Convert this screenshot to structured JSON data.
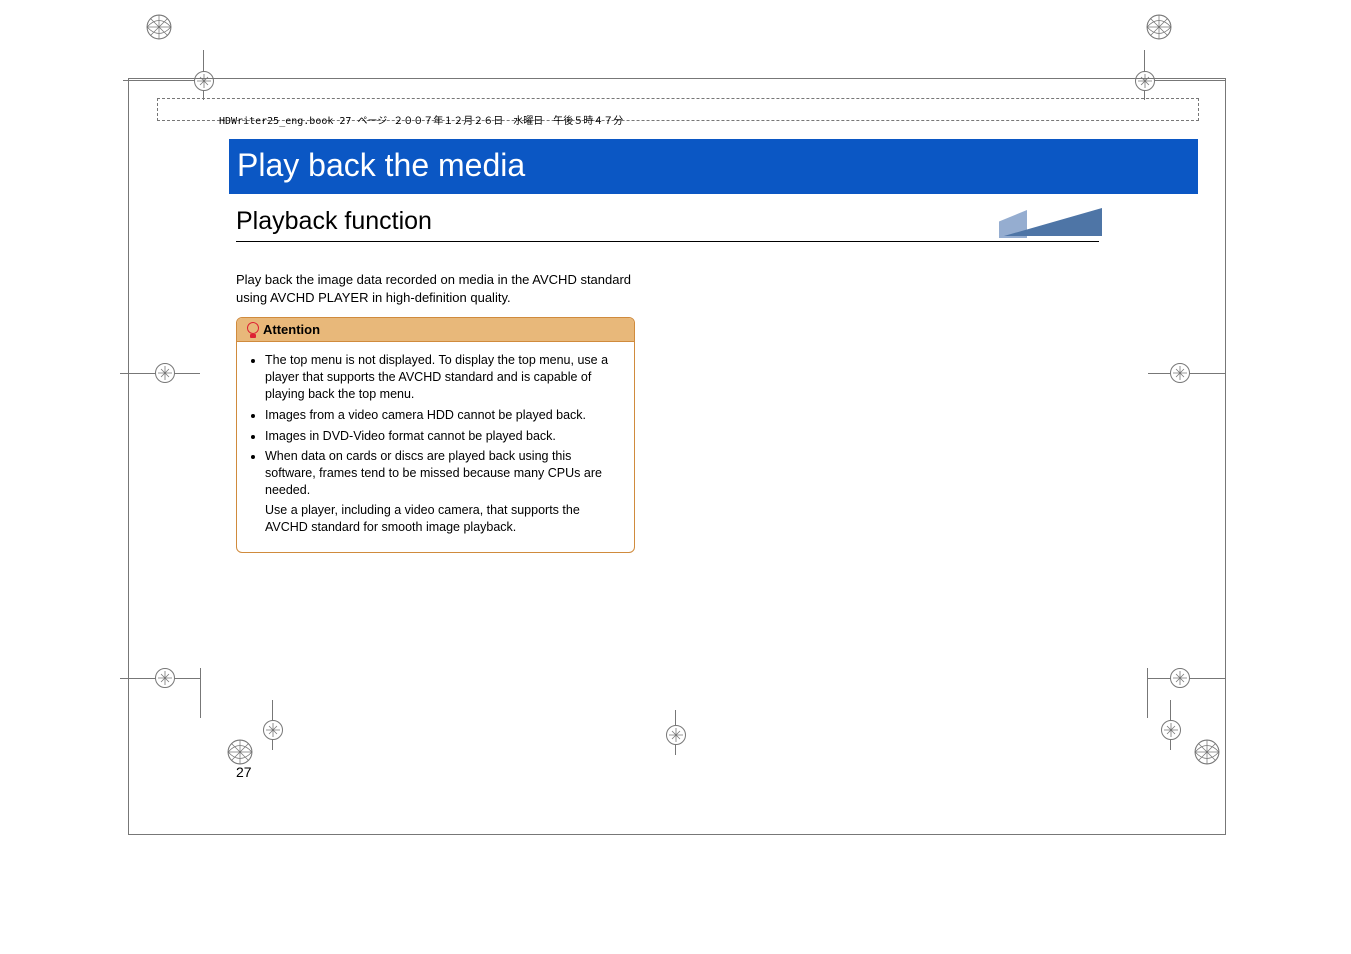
{
  "header_dash_text": "HDWriter25_eng.book  27 ページ  ２００７年１２月２６日　水曜日　午後５時４７分",
  "chapter_title": "Play back the media",
  "section_title": "Playback function",
  "intro_text": "Play back the image data recorded on media in the AVCHD standard using AVCHD PLAYER in high-definition quality.",
  "attention_label": "Attention",
  "attention_items": [
    "The top menu is not displayed. To display the top menu, use a player that supports the AVCHD standard and is capable of playing back the top menu.",
    "Images from a video camera HDD cannot be played back.",
    "Images in DVD-Video format cannot be played back.",
    "When data on cards or discs are played back using this software, frames tend to be missed because many CPUs are needed."
  ],
  "attention_continuation": "Use a player, including a video camera, that supports the AVCHD standard for smooth image playback.",
  "page_number": "27"
}
